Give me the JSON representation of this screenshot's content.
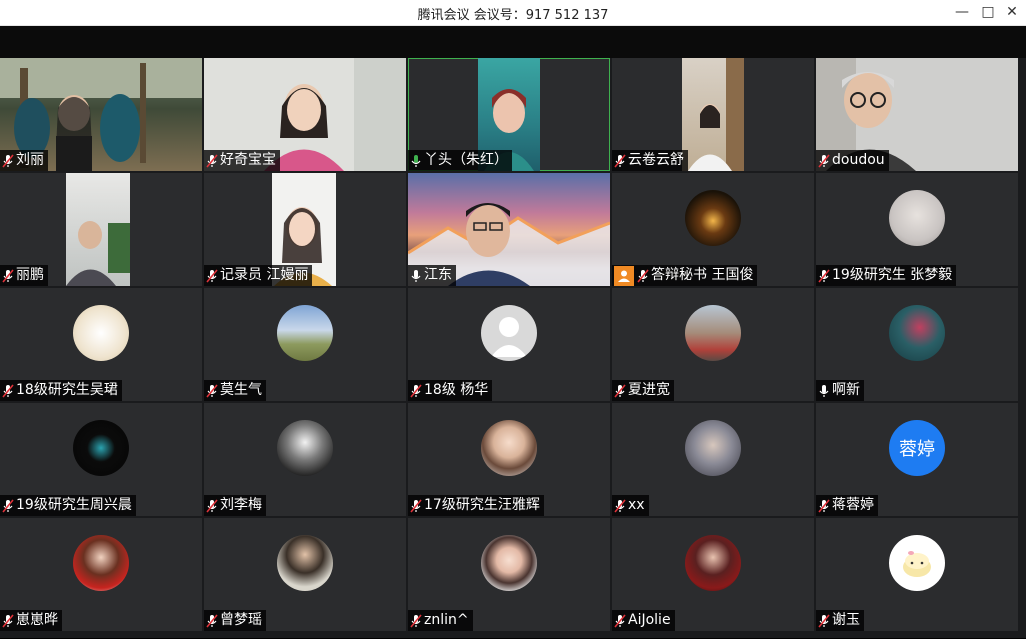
{
  "window": {
    "title": "腾讯会议 会议号：917 512 137",
    "minimize": "—",
    "maximize": "□",
    "close": "✕"
  },
  "participants": [
    {
      "name": "刘丽",
      "mic": "muted"
    },
    {
      "name": "好奇宝宝",
      "mic": "muted"
    },
    {
      "name": "丫头（朱红）",
      "mic": "speaking"
    },
    {
      "name": "云卷云舒",
      "mic": "muted"
    },
    {
      "name": "doudou",
      "mic": "muted"
    },
    {
      "name": "丽鹏",
      "mic": "muted"
    },
    {
      "name": "记录员 江嫚丽",
      "mic": "muted"
    },
    {
      "name": "江东",
      "mic": "on"
    },
    {
      "name": "答辩秘书 王国俊",
      "mic": "muted",
      "host": true
    },
    {
      "name": "19级研究生 张梦毅",
      "mic": "muted"
    },
    {
      "name": "18级研究生吴珺",
      "mic": "muted"
    },
    {
      "name": "莫生气",
      "mic": "muted"
    },
    {
      "name": "18级 杨华",
      "mic": "muted"
    },
    {
      "name": "夏进宽",
      "mic": "muted"
    },
    {
      "name": "啊新",
      "mic": "on"
    },
    {
      "name": "19级研究生周兴晨",
      "mic": "muted"
    },
    {
      "name": "刘李梅",
      "mic": "muted"
    },
    {
      "name": "17级研究生汪雅辉",
      "mic": "muted"
    },
    {
      "name": "xx",
      "mic": "muted"
    },
    {
      "name": "蒋蓉婷",
      "mic": "muted",
      "avatar_text": "蓉婷"
    },
    {
      "name": "崽崽晔",
      "mic": "muted"
    },
    {
      "name": "曾梦瑶",
      "mic": "muted"
    },
    {
      "name": "znlin^",
      "mic": "muted"
    },
    {
      "name": "AiJolie",
      "mic": "muted"
    },
    {
      "name": "谢玉",
      "mic": "muted"
    }
  ],
  "colors": {
    "active_speaker_border": "#3fb14f",
    "mic_muted": "#e0323a",
    "mic_speaking": "#3fb14f",
    "host_badge": "#f08a24",
    "text_avatar": "#1e7cf2"
  }
}
